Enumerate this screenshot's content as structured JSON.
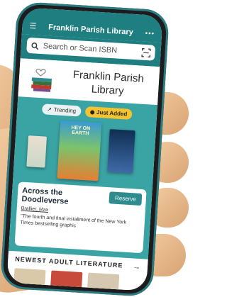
{
  "appbar": {
    "title": "Franklin Parish Library",
    "menu_icon": "hamburger-icon",
    "more_icon": "more-dots-icon"
  },
  "search": {
    "placeholder": "Search or Scan ISBN",
    "search_icon": "search-icon",
    "scan_icon": "barcode-scan-icon"
  },
  "brand": {
    "name": "Franklin Parish Library",
    "logo_icon": "library-books-logo"
  },
  "feature": {
    "tabs": [
      {
        "label": "Trending",
        "icon": "trending-icon",
        "active": false
      },
      {
        "label": "Just Added",
        "icon": "dot-icon",
        "active": true
      }
    ],
    "cover_text": "HEY ON EARTH",
    "book": {
      "title": "Across the Doodleverse",
      "author": "Brallier, Max",
      "description": "\"The fourth and final installment of the New York Times bestselling graphic",
      "reserve_label": "Reserve"
    }
  },
  "section": {
    "title": "NEWEST ADULT LITERATURE",
    "arrow_icon": "arrow-right-icon"
  },
  "colors": {
    "teal_dark": "#1e7e80",
    "teal": "#3aa3a4",
    "accent_yellow": "#f4c430"
  }
}
